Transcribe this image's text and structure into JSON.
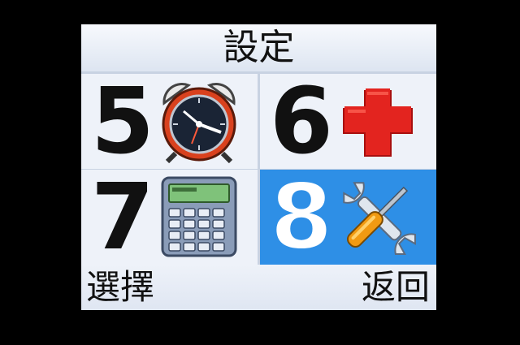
{
  "header": {
    "title": "設定"
  },
  "tiles": [
    {
      "number": "5",
      "icon": "alarm-clock-icon",
      "selected": false
    },
    {
      "number": "6",
      "icon": "red-cross-icon",
      "selected": false
    },
    {
      "number": "7",
      "icon": "calculator-icon",
      "selected": false
    },
    {
      "number": "8",
      "icon": "tools-icon",
      "selected": true
    }
  ],
  "softkeys": {
    "left": "選擇",
    "right": "返回"
  },
  "colors": {
    "selection": "#2e8fe6",
    "background": "#e8eef7",
    "bezel": "#000000"
  }
}
